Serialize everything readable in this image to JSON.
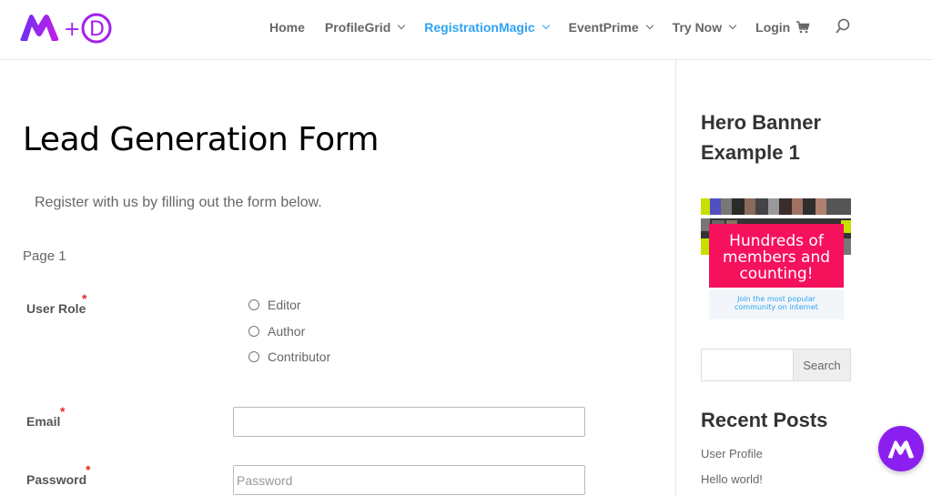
{
  "header": {
    "logo_plus": "+",
    "logo_letter": "D",
    "nav": [
      {
        "label": "Home",
        "has_dropdown": false,
        "active": false
      },
      {
        "label": "ProfileGrid",
        "has_dropdown": true,
        "active": false
      },
      {
        "label": "RegistrationMagic",
        "has_dropdown": true,
        "active": true
      },
      {
        "label": "EventPrime",
        "has_dropdown": true,
        "active": false
      },
      {
        "label": "Try Now",
        "has_dropdown": true,
        "active": false
      },
      {
        "label": "Login",
        "has_dropdown": false,
        "active": false
      }
    ],
    "cart_icon": "cart-icon",
    "search_icon": "search-icon",
    "active_color": "#2ea3f2",
    "brand_color": "#8b1ff0"
  },
  "main": {
    "title": "Lead Generation Form",
    "intro": "Register with us by filling out the form below.",
    "page_label": "Page 1",
    "required_mark": "*",
    "fields": {
      "user_role": {
        "label": "User Role",
        "options": [
          "Editor",
          "Author",
          "Contributor"
        ]
      },
      "email": {
        "label": "Email",
        "value": ""
      },
      "password": {
        "label": "Password",
        "placeholder": "Password"
      }
    }
  },
  "sidebar": {
    "widget_title": "Hero Banner Example 1",
    "banner": {
      "headline": "Hundreds of members and counting!",
      "subtext_line1": "Join the most popular",
      "subtext_line2": "community on internet",
      "headline_bg": "#f5115c"
    },
    "search": {
      "button_label": "Search",
      "value": ""
    },
    "recent_posts_title": "Recent Posts",
    "recent_posts": [
      "User Profile",
      "Hello world!"
    ]
  }
}
